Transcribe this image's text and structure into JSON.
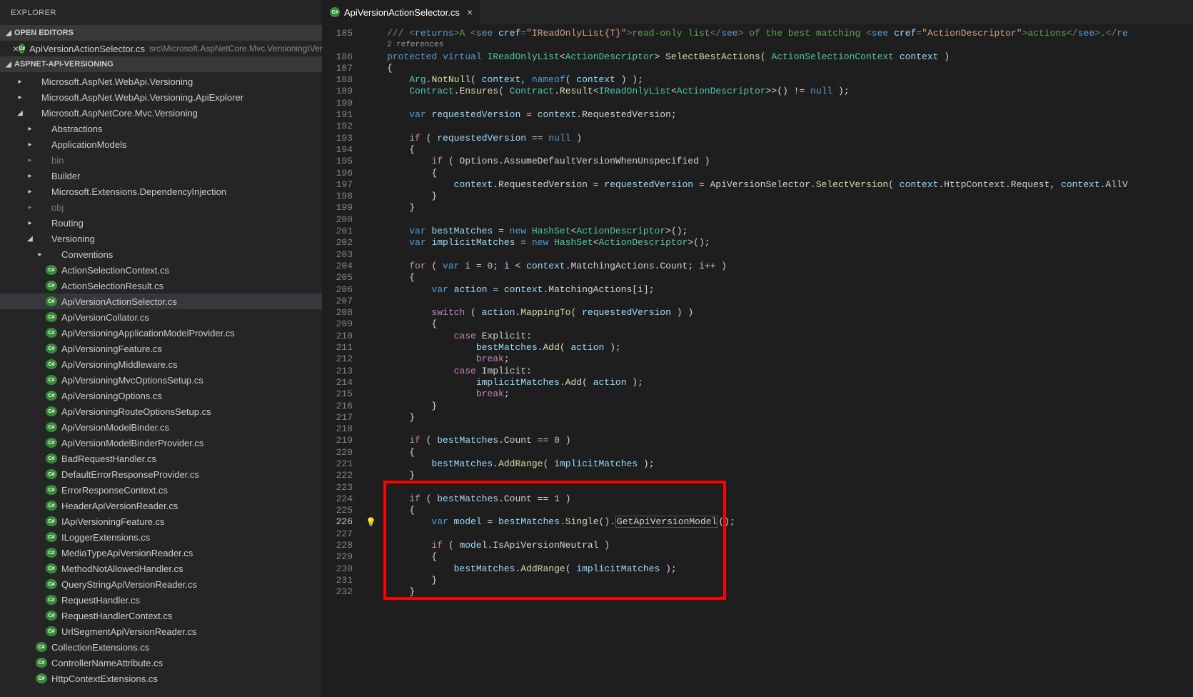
{
  "sidebar": {
    "title": "EXPLORER",
    "sections": {
      "openEditors": {
        "label": "OPEN EDITORS",
        "items": [
          {
            "name": "ApiVersionActionSelector.cs",
            "path": "src\\Microsoft.AspNetCore.Mvc.Versioning\\Versioning"
          }
        ]
      },
      "workspace": {
        "label": "ASPNET-API-VERSIONING",
        "tree": [
          {
            "indent": 1,
            "chev": "right",
            "label": "Microsoft.AspNet.WebApi.Versioning",
            "type": "folder"
          },
          {
            "indent": 1,
            "chev": "right",
            "label": "Microsoft.AspNet.WebApi.Versioning.ApiExplorer",
            "type": "folder"
          },
          {
            "indent": 1,
            "chev": "down",
            "label": "Microsoft.AspNetCore.Mvc.Versioning",
            "type": "folder"
          },
          {
            "indent": 2,
            "chev": "right",
            "label": "Abstractions",
            "type": "folder"
          },
          {
            "indent": 2,
            "chev": "right",
            "label": "ApplicationModels",
            "type": "folder"
          },
          {
            "indent": 2,
            "chev": "right",
            "label": "bin",
            "type": "folder",
            "dim": true
          },
          {
            "indent": 2,
            "chev": "right",
            "label": "Builder",
            "type": "folder"
          },
          {
            "indent": 2,
            "chev": "right",
            "label": "Microsoft.Extensions.DependencyInjection",
            "type": "folder"
          },
          {
            "indent": 2,
            "chev": "right",
            "label": "obj",
            "type": "folder",
            "dim": true
          },
          {
            "indent": 2,
            "chev": "right",
            "label": "Routing",
            "type": "folder"
          },
          {
            "indent": 2,
            "chev": "down",
            "label": "Versioning",
            "type": "folder"
          },
          {
            "indent": 3,
            "chev": "right",
            "label": "Conventions",
            "type": "folder"
          },
          {
            "indent": 3,
            "label": "ActionSelectionContext.cs",
            "type": "cs"
          },
          {
            "indent": 3,
            "label": "ActionSelectionResult.cs",
            "type": "cs"
          },
          {
            "indent": 3,
            "label": "ApiVersionActionSelector.cs",
            "type": "cs",
            "selected": true
          },
          {
            "indent": 3,
            "label": "ApiVersionCollator.cs",
            "type": "cs"
          },
          {
            "indent": 3,
            "label": "ApiVersioningApplicationModelProvider.cs",
            "type": "cs"
          },
          {
            "indent": 3,
            "label": "ApiVersioningFeature.cs",
            "type": "cs"
          },
          {
            "indent": 3,
            "label": "ApiVersioningMiddleware.cs",
            "type": "cs"
          },
          {
            "indent": 3,
            "label": "ApiVersioningMvcOptionsSetup.cs",
            "type": "cs"
          },
          {
            "indent": 3,
            "label": "ApiVersioningOptions.cs",
            "type": "cs"
          },
          {
            "indent": 3,
            "label": "ApiVersioningRouteOptionsSetup.cs",
            "type": "cs"
          },
          {
            "indent": 3,
            "label": "ApiVersionModelBinder.cs",
            "type": "cs"
          },
          {
            "indent": 3,
            "label": "ApiVersionModelBinderProvider.cs",
            "type": "cs"
          },
          {
            "indent": 3,
            "label": "BadRequestHandler.cs",
            "type": "cs"
          },
          {
            "indent": 3,
            "label": "DefaultErrorResponseProvider.cs",
            "type": "cs"
          },
          {
            "indent": 3,
            "label": "ErrorResponseContext.cs",
            "type": "cs"
          },
          {
            "indent": 3,
            "label": "HeaderApiVersionReader.cs",
            "type": "cs"
          },
          {
            "indent": 3,
            "label": "IApiVersioningFeature.cs",
            "type": "cs"
          },
          {
            "indent": 3,
            "label": "ILoggerExtensions.cs",
            "type": "cs"
          },
          {
            "indent": 3,
            "label": "MediaTypeApiVersionReader.cs",
            "type": "cs"
          },
          {
            "indent": 3,
            "label": "MethodNotAllowedHandler.cs",
            "type": "cs"
          },
          {
            "indent": 3,
            "label": "QueryStringApiVersionReader.cs",
            "type": "cs"
          },
          {
            "indent": 3,
            "label": "RequestHandler.cs",
            "type": "cs"
          },
          {
            "indent": 3,
            "label": "RequestHandlerContext.cs",
            "type": "cs"
          },
          {
            "indent": 3,
            "label": "UrlSegmentApiVersionReader.cs",
            "type": "cs"
          },
          {
            "indent": 2,
            "label": "CollectionExtensions.cs",
            "type": "cs"
          },
          {
            "indent": 2,
            "label": "ControllerNameAttribute.cs",
            "type": "cs"
          },
          {
            "indent": 2,
            "label": "HttpContextExtensions.cs",
            "type": "cs"
          }
        ]
      }
    }
  },
  "editor": {
    "tab": {
      "name": "ApiVersionActionSelector.cs"
    },
    "codelens": "2 references",
    "gutter": {
      "start": 185,
      "end": 232,
      "current": 226,
      "bulbLine": 226
    },
    "lines": {
      "l185": "/// <returns>A <see cref=\"IReadOnlyList{T}\">read-only list</see> of the best matching <see cref=\"ActionDescriptor\">actions</see>.</re",
      "l186": "protected virtual IReadOnlyList<ActionDescriptor> SelectBestActions( ActionSelectionContext context )",
      "l187": "{",
      "l188": "    Arg.NotNull( context, nameof( context ) );",
      "l189": "    Contract.Ensures( Contract.Result<IReadOnlyList<ActionDescriptor>>() != null );",
      "l191": "    var requestedVersion = context.RequestedVersion;",
      "l193": "    if ( requestedVersion == null )",
      "l194": "    {",
      "l195": "        if ( Options.AssumeDefaultVersionWhenUnspecified )",
      "l196": "        {",
      "l197": "            context.RequestedVersion = requestedVersion = ApiVersionSelector.SelectVersion( context.HttpContext.Request, context.AllV",
      "l198": "        }",
      "l199": "    }",
      "l201": "    var bestMatches = new HashSet<ActionDescriptor>();",
      "l202": "    var implicitMatches = new HashSet<ActionDescriptor>();",
      "l204": "    for ( var i = 0; i < context.MatchingActions.Count; i++ )",
      "l205": "    {",
      "l206": "        var action = context.MatchingActions[i];",
      "l208": "        switch ( action.MappingTo( requestedVersion ) )",
      "l209": "        {",
      "l210": "            case Explicit:",
      "l211": "                bestMatches.Add( action );",
      "l212": "                break;",
      "l213": "            case Implicit:",
      "l214": "                implicitMatches.Add( action );",
      "l215": "                break;",
      "l216": "        }",
      "l217": "    }",
      "l219": "    if ( bestMatches.Count == 0 )",
      "l220": "    {",
      "l221": "        bestMatches.AddRange( implicitMatches );",
      "l222": "    }",
      "l224": "    if ( bestMatches.Count == 1 )",
      "l225": "    {",
      "l226": "        var model = bestMatches.Single().GetApiVersionModel();",
      "l228": "        if ( model.IsApiVersionNeutral )",
      "l229": "        {",
      "l230": "            bestMatches.AddRange( implicitMatches );",
      "l231": "        }",
      "l232": "    }"
    }
  }
}
